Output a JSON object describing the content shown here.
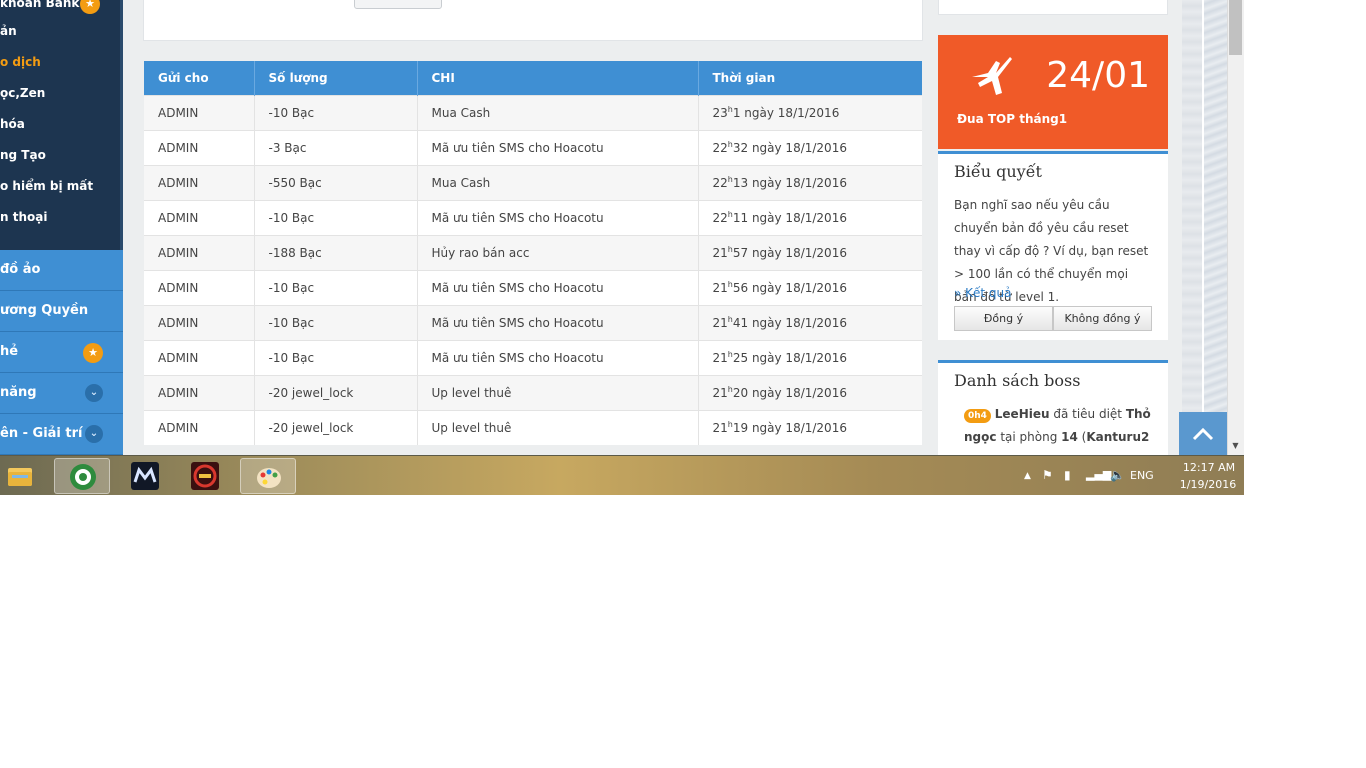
{
  "sidebar": {
    "items": [
      {
        "label": "khoản Bank",
        "badge": "★"
      },
      {
        "label": "ản"
      },
      {
        "label": "o dịch",
        "active": true
      },
      {
        "label": "ọc,Zen"
      },
      {
        "label": "hóa"
      },
      {
        "label": "ng Tạo"
      },
      {
        "label": "o hiểm bị mất"
      },
      {
        "label": "n thoại"
      }
    ],
    "blocks": [
      {
        "label": "đồ ảo"
      },
      {
        "label": "ương Quyền"
      },
      {
        "label": "hẻ",
        "badge": "★"
      },
      {
        "label": "năng",
        "chevron": "⌄"
      },
      {
        "label": "ên - Giải trí",
        "chevron": "⌄"
      }
    ]
  },
  "table": {
    "headers": [
      "Gửi cho",
      "Số lượng",
      "CHI",
      "Thời gian"
    ],
    "rows": [
      {
        "to": "ADMIN",
        "amount": "-10  Bạc",
        "chi": "Mua Cash",
        "hour": "23",
        "rest": "1 ngày 18/1/2016"
      },
      {
        "to": "ADMIN",
        "amount": "-3  Bạc",
        "chi": "Mã ưu tiên SMS cho Hoacotu",
        "hour": "22",
        "rest": "32 ngày 18/1/2016"
      },
      {
        "to": "ADMIN",
        "amount": "-550  Bạc",
        "chi": "Mua Cash",
        "hour": "22",
        "rest": "13 ngày 18/1/2016"
      },
      {
        "to": "ADMIN",
        "amount": "-10  Bạc",
        "chi": "Mã ưu tiên SMS cho Hoacotu",
        "hour": "22",
        "rest": "11 ngày 18/1/2016"
      },
      {
        "to": "ADMIN",
        "amount": "-188  Bạc",
        "chi": "Hủy rao bán acc",
        "hour": "21",
        "rest": "57 ngày 18/1/2016"
      },
      {
        "to": "ADMIN",
        "amount": "-10  Bạc",
        "chi": "Mã ưu tiên SMS cho Hoacotu",
        "hour": "21",
        "rest": "56 ngày 18/1/2016"
      },
      {
        "to": "ADMIN",
        "amount": "-10  Bạc",
        "chi": "Mã ưu tiên SMS cho Hoacotu",
        "hour": "21",
        "rest": "41 ngày 18/1/2016"
      },
      {
        "to": "ADMIN",
        "amount": "-10  Bạc",
        "chi": "Mã ưu tiên SMS cho Hoacotu",
        "hour": "21",
        "rest": "25 ngày 18/1/2016"
      },
      {
        "to": "ADMIN",
        "amount": "-20  jewel_lock",
        "chi": "Up level thuê",
        "hour": "21",
        "rest": "20 ngày 18/1/2016"
      },
      {
        "to": "ADMIN",
        "amount": "-20  jewel_lock",
        "chi": "Up level thuê",
        "hour": "21",
        "rest": "19 ngày 18/1/2016"
      }
    ]
  },
  "promo": {
    "date": "24/01",
    "label": "Đua TOP tháng1"
  },
  "poll": {
    "title": "Biểu quyết",
    "text": "Bạn nghĩ sao nếu yêu cầu chuyển bản đồ yêu cầu reset thay vì cấp độ ? Ví dụ, bạn reset > 100 lần có thể chuyển mọi bản đồ từ level 1.",
    "result_label": "» Kết quả",
    "agree_label": "Đồng ý",
    "disagree_label": "Không đồng ý"
  },
  "boss": {
    "title": "Danh sách boss",
    "badge": "0h4",
    "player": "LeeHieu",
    "action": " đã tiêu diệt ",
    "boss_name": "Thỏ ngọc",
    "place_prefix": " tại phòng ",
    "room": "14",
    "map_open": " (",
    "map": "Kanturu2"
  },
  "scroll_top_icon": "chevron-up-icon",
  "taskbar": {
    "lang": "ENG",
    "time": "12:17 AM",
    "date": "1/19/2016"
  },
  "colors": {
    "sidebar": "#1d3550",
    "accent_blue": "#3f8fd3",
    "promo_orange": "#f05a28",
    "badge_orange": "#f39c12"
  }
}
